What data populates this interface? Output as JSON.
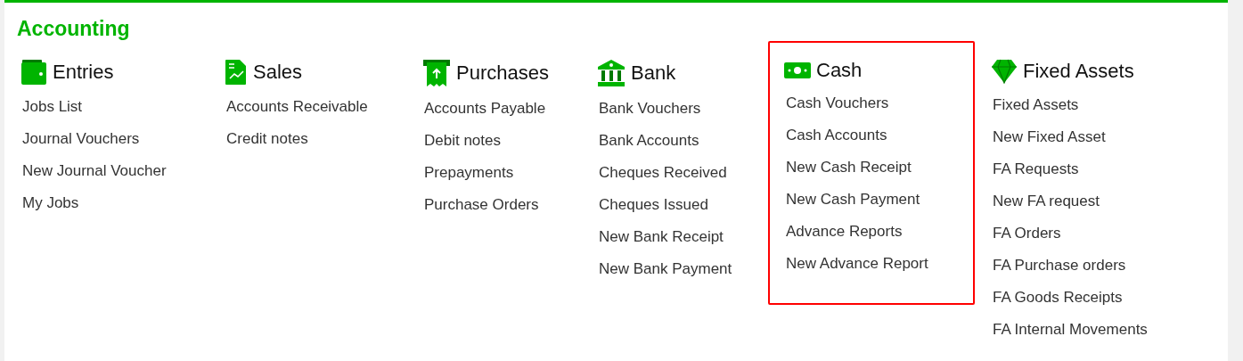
{
  "title": "Accounting",
  "columns": [
    {
      "kind": "wallet",
      "heading": "Entries",
      "highlighted": false,
      "items": [
        "Jobs List",
        "Journal Vouchers",
        "New Journal Voucher",
        "My Jobs"
      ]
    },
    {
      "kind": "document",
      "heading": "Sales",
      "highlighted": false,
      "items": [
        "Accounts Receivable",
        "Credit notes"
      ]
    },
    {
      "kind": "receipt",
      "heading": "Purchases",
      "highlighted": false,
      "items": [
        "Accounts Payable",
        "Debit notes",
        "Prepayments",
        "Purchase Orders"
      ]
    },
    {
      "kind": "bank",
      "heading": "Bank",
      "highlighted": false,
      "items": [
        "Bank Vouchers",
        "Bank Accounts",
        "Cheques Received",
        "Cheques Issued",
        "New Bank Receipt",
        "New Bank Payment"
      ]
    },
    {
      "kind": "cash",
      "heading": "Cash",
      "highlighted": true,
      "items": [
        "Cash Vouchers",
        "Cash Accounts",
        "New Cash Receipt",
        "New Cash Payment",
        "Advance Reports",
        "New Advance Report"
      ]
    },
    {
      "kind": "gem",
      "heading": "Fixed Assets",
      "highlighted": false,
      "items": [
        "Fixed Assets",
        "New Fixed Asset",
        "FA Requests",
        "New FA request",
        "FA Orders",
        "FA Purchase orders",
        "FA Goods Receipts",
        "FA Internal Movements"
      ]
    }
  ]
}
